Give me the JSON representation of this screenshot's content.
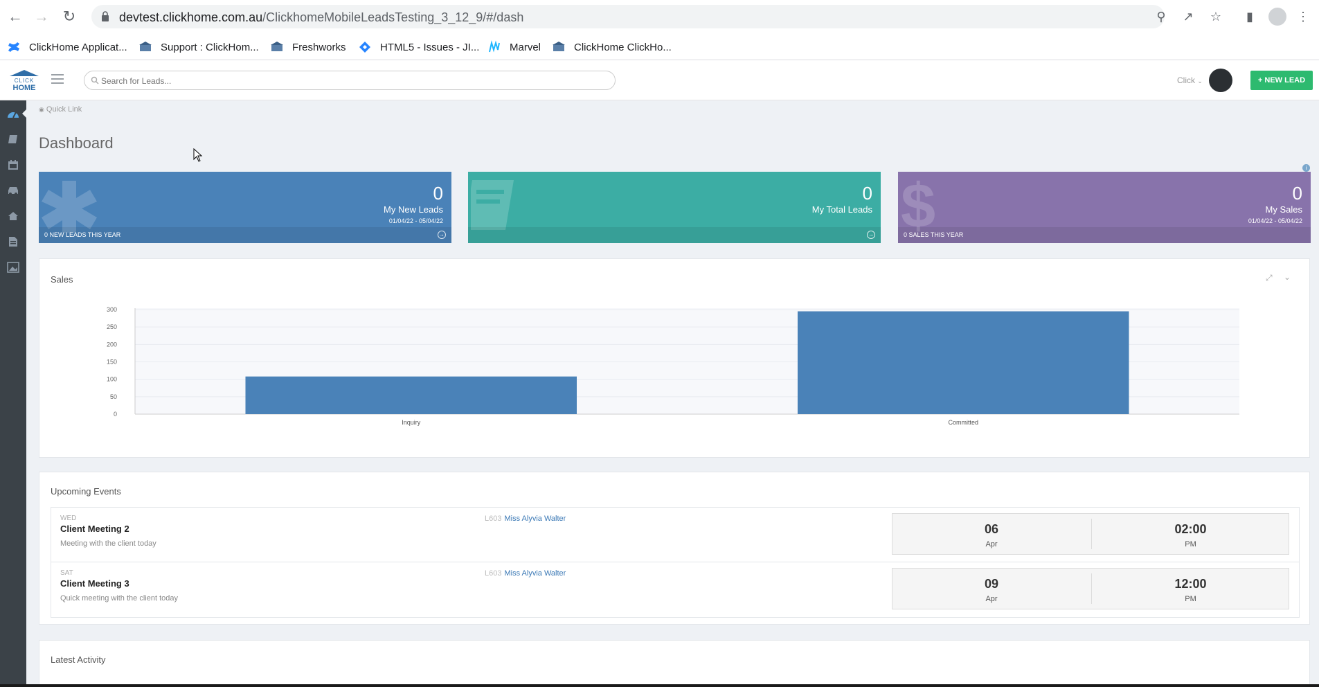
{
  "browser": {
    "url_host": "devtest.clickhome.com.au",
    "url_path": "/ClickhomeMobileLeadsTesting_3_12_9/#/dash",
    "bookmarks": [
      {
        "label": "ClickHome Applicat..."
      },
      {
        "label": "Support : ClickHom..."
      },
      {
        "label": "Freshworks"
      },
      {
        "label": "HTML5 - Issues - JI..."
      },
      {
        "label": "Marvel"
      },
      {
        "label": "ClickHome ClickHo..."
      }
    ]
  },
  "header": {
    "search_placeholder": "Search for Leads...",
    "user_name": "Click",
    "new_lead_label": "+ NEW LEAD"
  },
  "leftnav": {
    "icons": [
      "dashboard-icon",
      "book-icon",
      "calendar-icon",
      "car-icon",
      "home-icon",
      "document-icon",
      "gallery-icon"
    ]
  },
  "main": {
    "quick_link": "Quick Link",
    "title": "Dashboard",
    "stats": [
      {
        "value": "0",
        "label": "My New Leads",
        "dates": "01/04/22 - 05/04/22",
        "footer": "0 NEW LEADS THIS YEAR",
        "color": "#4a82b8"
      },
      {
        "value": "0",
        "label": "My Total Leads",
        "dates": "",
        "footer": "",
        "color": "#3cada4"
      },
      {
        "value": "0",
        "label": "My Sales",
        "dates": "01/04/22 - 05/04/22",
        "footer": "0 SALES THIS YEAR",
        "color": "#8873ab"
      }
    ],
    "sales_title": "Sales",
    "events_title": "Upcoming Events",
    "events": [
      {
        "day": "WED",
        "title": "Client Meeting 2",
        "desc": "Meeting with the client today",
        "code": "L603",
        "person": "Miss Alyvia Walter",
        "date": "06",
        "month": "Apr",
        "time": "02:00",
        "ampm": "PM"
      },
      {
        "day": "SAT",
        "title": "Client Meeting 3",
        "desc": "Quick meeting with the client today",
        "code": "L603",
        "person": "Miss Alyvia Walter",
        "date": "09",
        "month": "Apr",
        "time": "12:00",
        "ampm": "PM"
      }
    ],
    "activity_title": "Latest Activity"
  },
  "chart_data": {
    "type": "bar",
    "title": "Sales",
    "categories": [
      "Inquiry",
      "Committed"
    ],
    "values": [
      108,
      295
    ],
    "ylim": [
      0,
      300
    ],
    "yticks": [
      0,
      50,
      100,
      150,
      200,
      250,
      300
    ],
    "grid": true,
    "bar_color": "#4a82b8"
  }
}
